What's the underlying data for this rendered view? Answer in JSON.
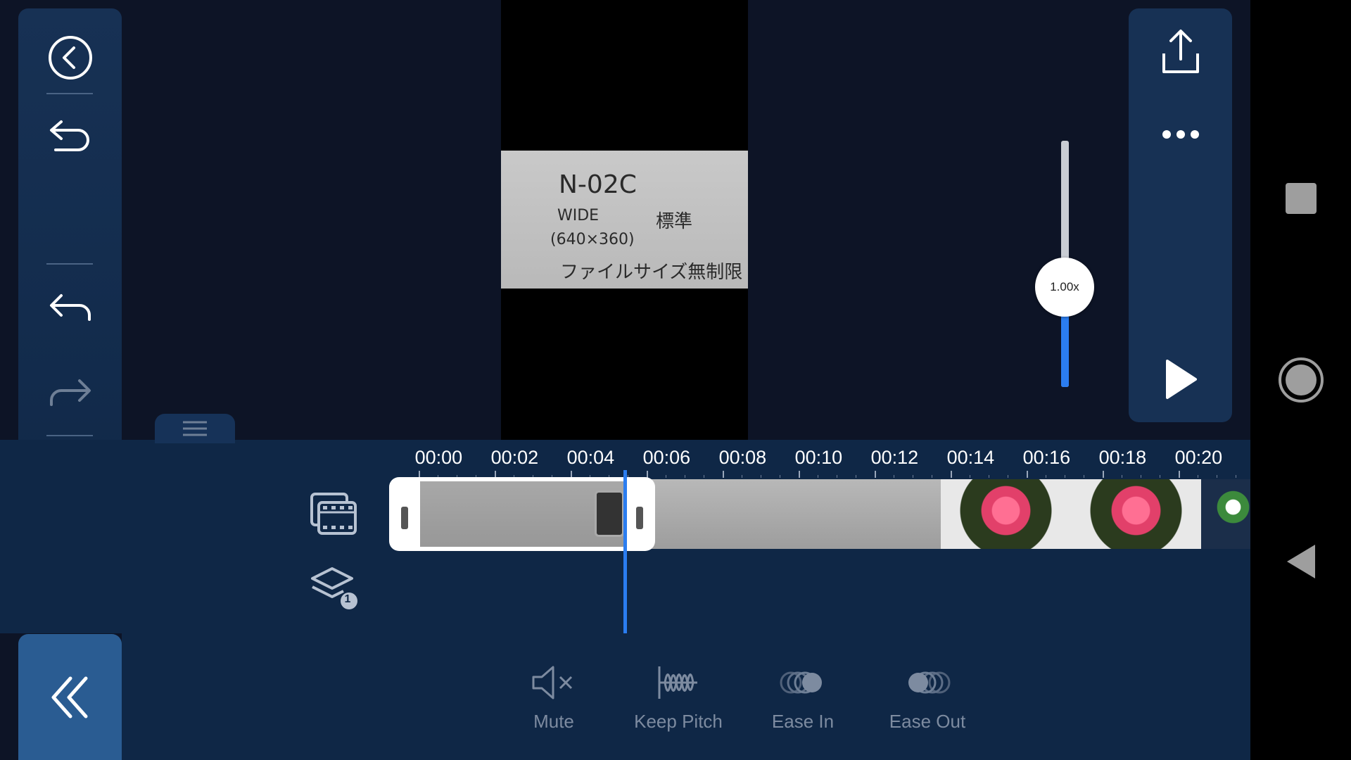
{
  "left_panel": {
    "back_icon": "chevron-left-circle-icon",
    "undo_icon": "undo-icon",
    "step_back_icon": "arrow-back-icon",
    "step_forward_icon": "arrow-forward-icon",
    "delete_icon": "trash-icon",
    "collapse_icon": "double-chevron-left-icon"
  },
  "right_panel": {
    "export_icon": "share-upload-icon",
    "more_icon": "more-horizontal-icon",
    "play_icon": "play-icon"
  },
  "speed": {
    "label": "1.00x",
    "level": 0.3
  },
  "preview": {
    "note_lines": [
      "N-02C",
      "WIDE",
      "標準",
      "(640×360)",
      "ファイルサイズ無制限"
    ]
  },
  "timeline": {
    "ticks": [
      "00:00",
      "00:02",
      "00:04",
      "00:06",
      "00:08",
      "00:10",
      "00:12",
      "00:14",
      "00:16",
      "00:18",
      "00:20"
    ],
    "layers_count": "1"
  },
  "toolbar": {
    "items": [
      {
        "label": "Mute",
        "icon": "speaker-mute-icon"
      },
      {
        "label": "Keep Pitch",
        "icon": "waveform-icon"
      },
      {
        "label": "Ease In",
        "icon": "ease-in-icon"
      },
      {
        "label": "Ease Out",
        "icon": "ease-out-icon"
      }
    ]
  },
  "colors": {
    "accent": "#2b7df0",
    "panel": "#173154",
    "background": "#0d1426"
  }
}
